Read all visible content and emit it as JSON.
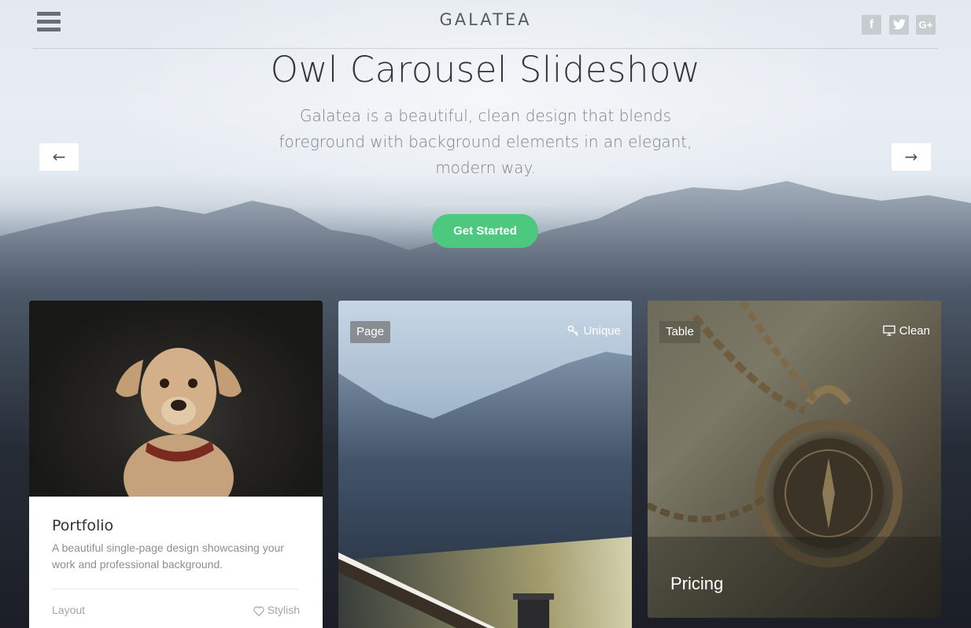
{
  "header": {
    "brand": "GALATEA",
    "menu_icon": "hamburger-menu-icon",
    "social": [
      {
        "label": "f",
        "icon": "facebook-icon"
      },
      {
        "label": "t",
        "icon": "twitter-icon"
      },
      {
        "label": "G+",
        "icon": "google-plus-icon"
      }
    ]
  },
  "hero": {
    "title": "Owl Carousel Slideshow",
    "subtitle": "Galatea is a beautiful, clean design that blends foreground with background elements in an elegant, modern way.",
    "prev_arrow": "←",
    "next_arrow": "→",
    "cta_label": "Get Started"
  },
  "cards": [
    {
      "title": "Portfolio",
      "description": "A beautiful single-page design showcasing your work and professional background.",
      "footer_left": "Layout",
      "footer_right": "Stylish",
      "footer_right_icon": "heart-icon",
      "image": "dog-photo"
    },
    {
      "badge": "Page",
      "tag": "Unique",
      "tag_icon": "key-icon",
      "image": "snowy-forest-mountain-photo"
    },
    {
      "badge": "Table",
      "tag": "Clean",
      "tag_icon": "monitor-icon",
      "title": "Pricing",
      "image": "compass-chain-photo"
    }
  ],
  "colors": {
    "accent": "#4cc97f",
    "text_dark": "#32363c",
    "text_muted": "#7c8289"
  }
}
